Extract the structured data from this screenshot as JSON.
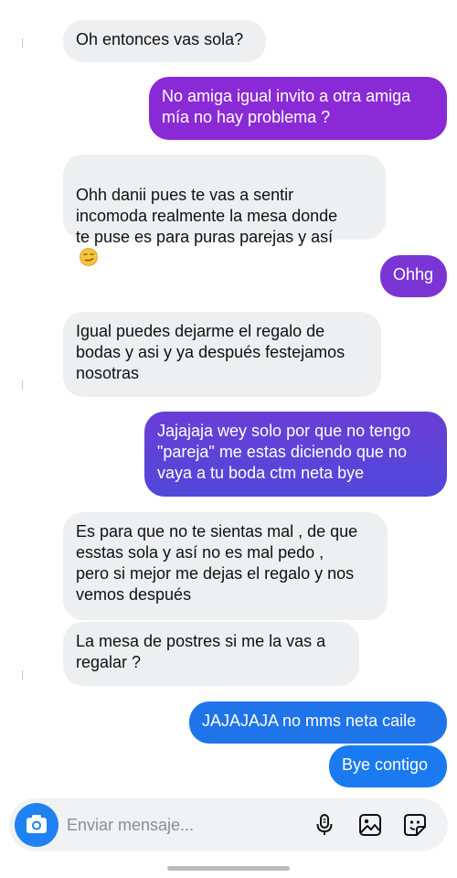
{
  "messages": [
    {
      "text": "Oh entonces vas sola?",
      "side": "in"
    },
    {
      "text": "No amiga igual invito a otra amiga\nmía no hay problema ?",
      "side": "out",
      "color": "#8a2ad6"
    },
    {
      "text": "Ohh danii pues te vas a sentir\nincomoda realmente la mesa donde\nte puse es para puras parejas y así",
      "side": "in",
      "emoji": "smirk-emoji"
    },
    {
      "text": "Ohhg",
      "side": "out",
      "color": "#7a35d4"
    },
    {
      "text": "Igual puedes dejarme el regalo de\nbodas y asi y ya después festejamos\nnosotras",
      "side": "in"
    },
    {
      "text": "Jajajaja wey solo por que no tengo\n\"pareja\" me estas diciendo que no\nvaya a tu boda ctm neta bye",
      "side": "out",
      "color": "#5b46d8"
    },
    {
      "text": "Es para que no te sientas mal , de que\nesstas sola y así no es mal pedo ,\npero si mejor me dejas el regalo y nos\nvemos después",
      "side": "in"
    },
    {
      "text": "La mesa de postres si me la vas a\nregalar ?",
      "side": "in"
    },
    {
      "text": "JAJAJAJA no mms neta caile",
      "side": "out",
      "color": "#1f74ea"
    },
    {
      "text": "Bye contigo",
      "side": "out",
      "color": "#1a7af0"
    }
  ],
  "composer": {
    "placeholder": "Enviar mensaje...",
    "icons": [
      "camera-icon",
      "microphone-icon",
      "gallery-icon",
      "sticker-icon"
    ]
  },
  "colors": {
    "incoming_bubble": "#eeeff1",
    "camera_button": "#1e82f2"
  }
}
